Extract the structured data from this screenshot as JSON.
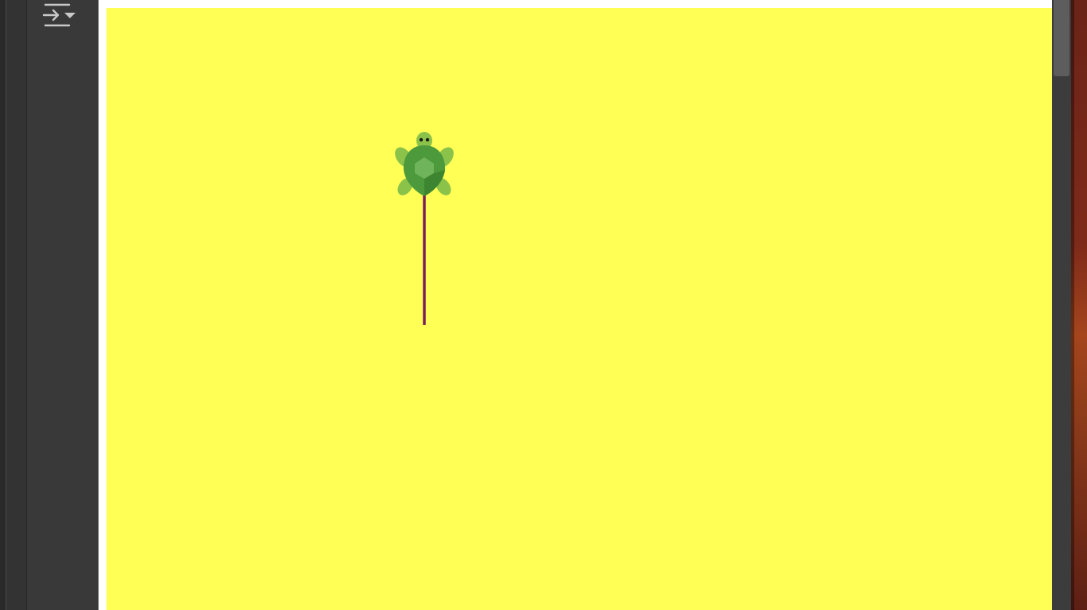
{
  "sidebar": {
    "toolbar_icon": "convert-dropdown-icon"
  },
  "canvas": {
    "background_color": "#ffff55",
    "pen_color": "#7a1f5c",
    "turtle_heading": "up",
    "turtle_icon": "turtle-sprite"
  },
  "colors": {
    "panel": "#393939",
    "frame": "#ffffff",
    "turtle_shell": "#4c9a3c",
    "turtle_skin": "#8bc34a"
  }
}
